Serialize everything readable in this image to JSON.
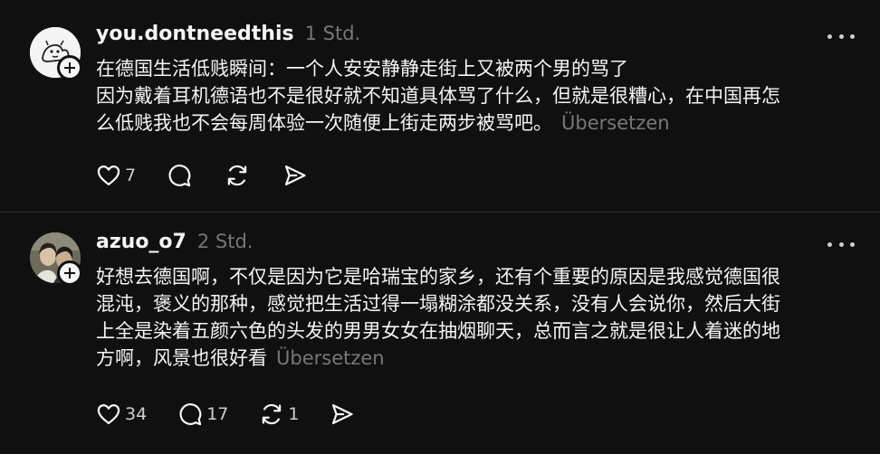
{
  "posts": [
    {
      "username": "you.dontneedthis",
      "time": "1 Std.",
      "lines": [
        "在德国生活低贱瞬间：一个人安安静静走街上又被两个男的骂了",
        "因为戴着耳机德语也不是很好就不知道具体骂了什么，但就是很糟心，在中国再怎",
        "么低贱我也不会每周体验一次随便上街走两步被骂吧。"
      ],
      "translate": "Übersetzen",
      "likes": "7",
      "replies": "",
      "reposts": ""
    },
    {
      "username": "azuo_o7",
      "time": "2 Std.",
      "lines": [
        "好想去德国啊，不仅是因为它是哈瑞宝的家乡，还有个重要的原因是我感觉德国很",
        "混沌，褒义的那种，感觉把生活过得一塌糊涂都没关系，没有人会说你，然后大街",
        "上全是染着五颜六色的头发的男男女女在抽烟聊天，总而言之就是很让人着迷的地",
        "方啊，风景也很好看"
      ],
      "translate": "Übersetzen",
      "likes": "34",
      "replies": "17",
      "reposts": "1"
    }
  ],
  "icons": [
    "heart-icon",
    "reply-icon",
    "repost-icon",
    "share-icon",
    "more-icon",
    "follow-plus-icon"
  ],
  "colors": {
    "background": "#101010",
    "text": "#f3f5f7",
    "secondary": "#777777",
    "divider": "#2b2b2b"
  }
}
